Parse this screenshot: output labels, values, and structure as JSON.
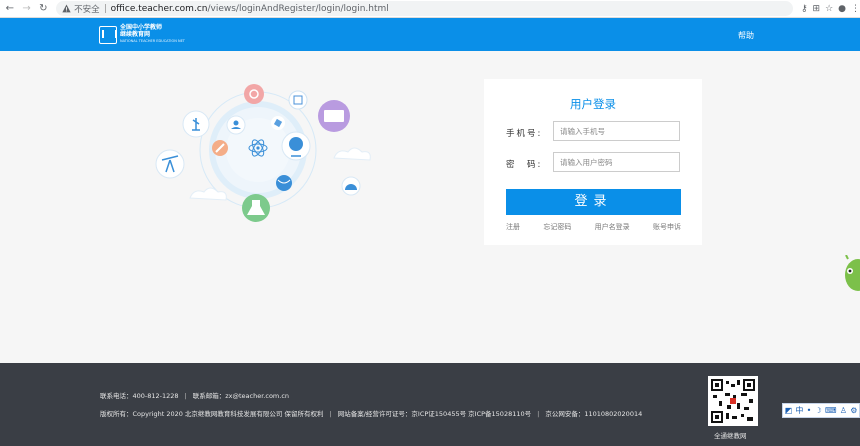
{
  "browser": {
    "security_label": "不安全",
    "url_host": "office.teacher.com.cn",
    "url_path": "/views/loginAndRegister/login/login.html"
  },
  "header": {
    "logo_title_line1": "全国中小学教师",
    "logo_title_line2": "继续教育网",
    "logo_subtitle": "NATIONAL TEACHER EDUCATION NET",
    "help_label": "帮助"
  },
  "login": {
    "title": "用户登录",
    "phone_label": "手机号:",
    "phone_placeholder": "请输入手机号",
    "password_label": "密　码:",
    "password_placeholder": "请输入用户密码",
    "submit_label": "登录",
    "links": [
      "注册",
      "忘记密码",
      "用户名登录",
      "账号申诉"
    ]
  },
  "footer": {
    "phone": "联系电话：400-812-1228",
    "email": "联系邮箱：zx@teacher.com.cn",
    "copyright": "版权所有：Copyright 2020 北京继教网教育科技发展有限公司 保留所有权利",
    "icp": "网站备案/经营许可证号：京ICP证150455号 京ICP备15028110号",
    "police": "京公网安备：11010802020014",
    "qr_caption": "全通继教网"
  },
  "ime": {
    "lang": "中"
  },
  "colors": {
    "brand_blue": "#0a8fe8",
    "footer_bg": "#3a3e45",
    "page_bg": "#f6f6f6"
  }
}
